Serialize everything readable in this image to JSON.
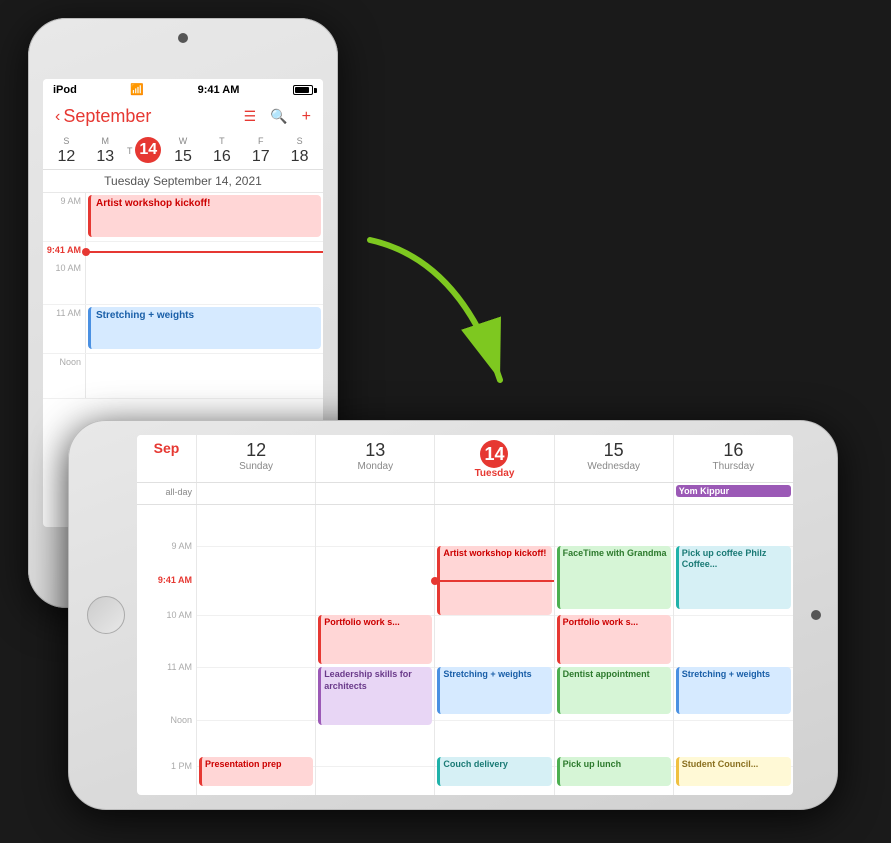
{
  "devices": {
    "vertical": {
      "status_bar": {
        "carrier": "iPod",
        "wifi": "wifi",
        "time": "9:41 AM",
        "battery": "battery"
      },
      "header": {
        "back_label": "September",
        "icons": [
          "list",
          "search",
          "plus"
        ]
      },
      "week_days": [
        "S",
        "M",
        "T",
        "W",
        "T",
        "F",
        "S"
      ],
      "week_dates": [
        "12",
        "13",
        "14",
        "15",
        "16",
        "17",
        "18"
      ],
      "today_index": 2,
      "date_label": "Tuesday  September 14, 2021",
      "time_slots": [
        {
          "label": "9 AM",
          "events": [
            {
              "text": "Artist workshop kickoff!",
              "type": "pink",
              "top": 0,
              "height": 44
            }
          ]
        },
        {
          "label": "9:41 AM",
          "is_now": true
        },
        {
          "label": "10 AM",
          "events": []
        },
        {
          "label": "11 AM",
          "events": [
            {
              "text": "Stretching + weights",
              "type": "blue",
              "top": 0,
              "height": 40
            }
          ]
        },
        {
          "label": "Noon",
          "events": []
        }
      ]
    },
    "horizontal": {
      "columns": [
        {
          "month": "Sep",
          "num": "12",
          "day": "Sunday",
          "is_today": false
        },
        {
          "month": "",
          "num": "13",
          "day": "Monday",
          "is_today": false
        },
        {
          "month": "",
          "num": "14",
          "day": "Tuesday",
          "is_today": true
        },
        {
          "month": "",
          "num": "15",
          "day": "Wednesday",
          "is_today": false
        },
        {
          "month": "",
          "num": "16",
          "day": "Thursday",
          "is_today": false
        }
      ],
      "all_day_label": "all-day",
      "all_day_events": [
        {
          "col": 4,
          "text": "Yom Kippur",
          "color": "#9b59b6"
        }
      ],
      "time_labels": [
        "9 AM",
        "9:41 AM",
        "10 AM",
        "11 AM",
        "Noon",
        "1 PM"
      ],
      "now_time_label": "9:41 AM",
      "events": [
        {
          "col": 2,
          "text": "Artist workshop kickoff!",
          "type": "pink",
          "time_start": "9:00",
          "time_end": "10:00"
        },
        {
          "col": 1,
          "text": "Portfolio work s...",
          "type": "pink",
          "time_start": "10:00",
          "time_end": "11:00"
        },
        {
          "col": 3,
          "text": "Portfolio work s...",
          "type": "pink",
          "time_start": "10:00",
          "time_end": "11:00"
        },
        {
          "col": 1,
          "text": "Leadership skills for architects",
          "type": "purple",
          "time_start": "11:00",
          "time_end": "12:30"
        },
        {
          "col": 2,
          "text": "Stretching + weights",
          "type": "blue",
          "time_start": "11:00",
          "time_end": "12:00"
        },
        {
          "col": 3,
          "text": "Dentist appointment",
          "type": "green",
          "time_start": "11:00",
          "time_end": "12:00"
        },
        {
          "col": 4,
          "text": "Stretching + weights",
          "type": "blue",
          "time_start": "11:00",
          "time_end": "12:00"
        },
        {
          "col": 3,
          "text": "FaceTime with Grandma",
          "type": "green",
          "time_start": "9:00",
          "time_end": "10:00"
        },
        {
          "col": 4,
          "text": "Pick up coffee Philz Coffee...",
          "type": "teal",
          "time_start": "9:00",
          "time_end": "10:00"
        },
        {
          "col": 1,
          "text": "Presentation prep",
          "type": "pink",
          "time_start": "13:00",
          "time_end": "14:00"
        },
        {
          "col": 2,
          "text": "Couch delivery",
          "type": "teal",
          "time_start": "13:00",
          "time_end": "14:00"
        },
        {
          "col": 3,
          "text": "Pick up lunch",
          "type": "green",
          "time_start": "13:00",
          "time_end": "14:00"
        },
        {
          "col": 4,
          "text": "Student Council...",
          "type": "yellow",
          "time_start": "13:00",
          "time_end": "14:00"
        }
      ]
    }
  },
  "arrow": {
    "label": "green arrow pointing from vertical device to horizontal device"
  }
}
